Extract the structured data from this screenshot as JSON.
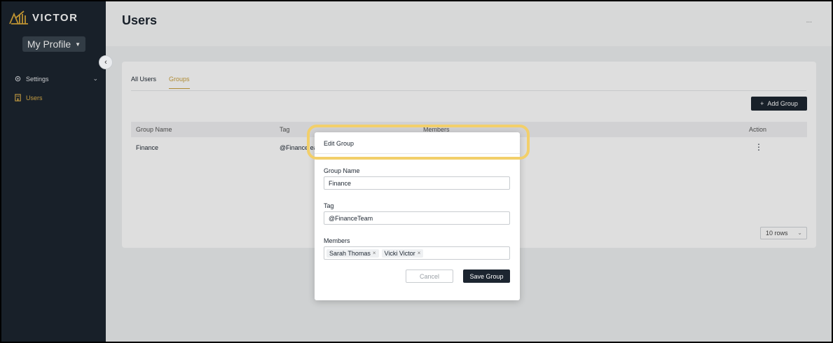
{
  "brand": {
    "name": "VICTOR"
  },
  "sidebar": {
    "profile_label": "My Profile",
    "items": [
      {
        "label": "Settings",
        "icon": "gear-icon"
      },
      {
        "label": "Users",
        "icon": "building-icon",
        "active": true
      }
    ]
  },
  "header": {
    "title": "Users",
    "more": "..."
  },
  "tabs": [
    {
      "label": "All Users"
    },
    {
      "label": "Groups",
      "active": true
    }
  ],
  "toolbar": {
    "add_group_label": "Add Group",
    "add_icon": "+"
  },
  "table": {
    "columns": [
      "Group Name",
      "Tag",
      "Members",
      "Action"
    ],
    "rows": [
      {
        "name": "Finance",
        "tag": "@FinanceTeam",
        "tag_visible": "@Finance ea",
        "action": "⋮"
      }
    ]
  },
  "pagination": {
    "rows_label": "10 rows"
  },
  "modal": {
    "title": "Edit Group",
    "group_name_label": "Group Name",
    "group_name_value": "Finance",
    "tag_label": "Tag",
    "tag_value": "@FinanceTeam",
    "members_label": "Members",
    "members": [
      "Sarah Thomas",
      "Vicki Victor"
    ],
    "cancel_label": "Cancel",
    "save_label": "Save Group"
  },
  "colors": {
    "sidebar": "#1c2530",
    "accent": "#c9a03c",
    "highlight": "#f2cf6a"
  }
}
